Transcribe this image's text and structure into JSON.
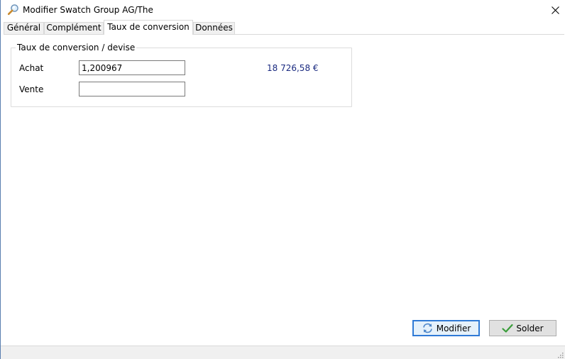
{
  "window": {
    "title": "Modifier Swatch Group AG/The",
    "icon": "magnifier-icon",
    "close_icon": "close-icon"
  },
  "tabs": [
    {
      "label": "Général",
      "active": false
    },
    {
      "label": "Complément",
      "active": false
    },
    {
      "label": "Taux de conversion",
      "active": true
    },
    {
      "label": "Données",
      "active": false
    }
  ],
  "conversion": {
    "group_title": "Taux de conversion / devise",
    "achat_label": "Achat",
    "achat_value": "1,200967",
    "achat_amount": "18 726,58 €",
    "vente_label": "Vente",
    "vente_value": ""
  },
  "buttons": {
    "modifier_label": "Modifier",
    "modifier_icon": "refresh-icon",
    "solder_label": "Solder",
    "solder_icon": "checkmark-icon"
  },
  "colors": {
    "amount_text": "#1a2a80",
    "default_button_border": "#2f7ad6",
    "check_green": "#3a9d3a"
  }
}
